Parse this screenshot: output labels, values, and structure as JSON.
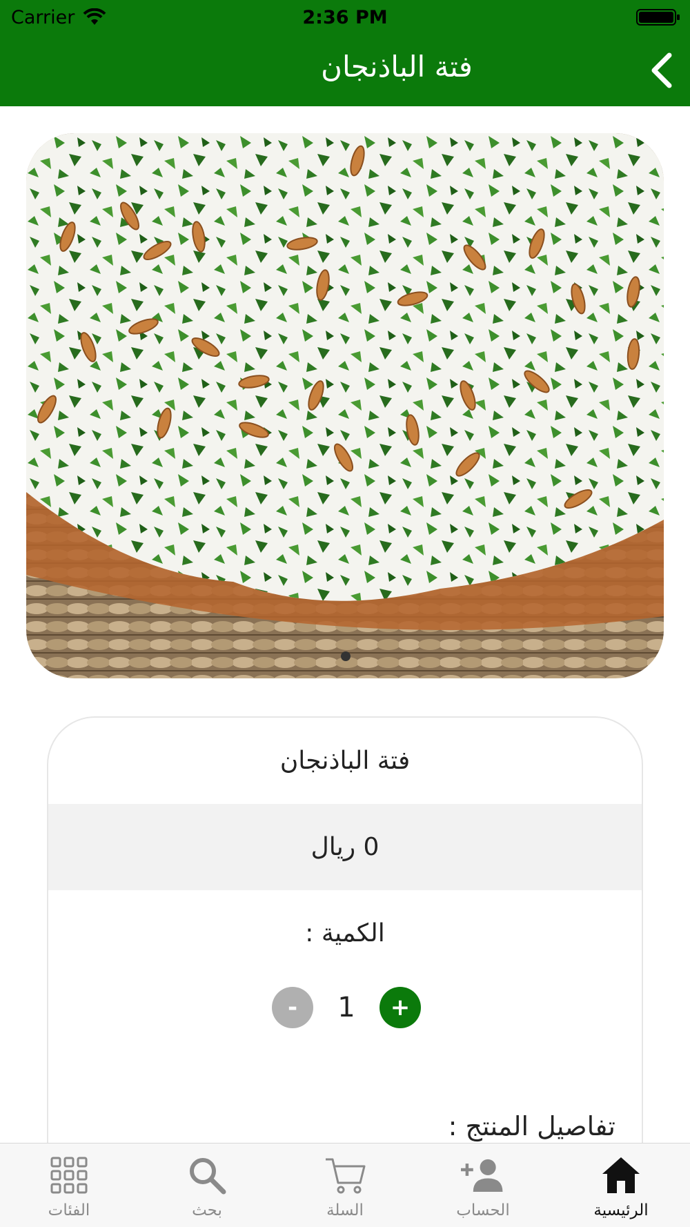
{
  "status_bar": {
    "carrier": "Carrier",
    "time": "2:36 PM"
  },
  "header": {
    "title": "فتة الباذنجان",
    "back_icon": "chevron-left-icon"
  },
  "product": {
    "name": "فتة الباذنجان",
    "price": "0 ريال",
    "quantity_label": "الكمية :",
    "quantity_value": "1",
    "minus_label": "-",
    "plus_label": "+",
    "details_label": "تفاصيل المنتج :"
  },
  "tab_bar": {
    "tabs": [
      {
        "label": "الفئات",
        "icon": "grid-icon",
        "active": false
      },
      {
        "label": "بحث",
        "icon": "search-icon",
        "active": false
      },
      {
        "label": "السلة",
        "icon": "cart-icon",
        "active": false
      },
      {
        "label": "الحساب",
        "icon": "add-user-icon",
        "active": false
      },
      {
        "label": "الرئيسية",
        "icon": "home-icon",
        "active": true
      }
    ]
  },
  "colors": {
    "brand": "#0b7a0b",
    "minus_button": "#b0b0b0",
    "price_row_bg": "#f2f2f2"
  }
}
